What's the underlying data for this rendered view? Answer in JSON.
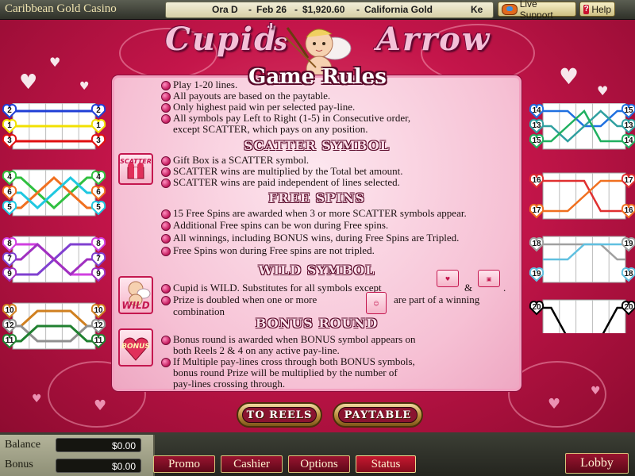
{
  "topbar": {
    "brand": "Caribbean Gold Casino",
    "session": {
      "name": "Ora D",
      "date": "Feb 26",
      "amount": "$1,920.60",
      "game": "California Gold",
      "tail": "Ke"
    },
    "live_support": "Live Support",
    "help": "Help"
  },
  "title": {
    "c": "Cupid",
    "s": "s",
    "a": "Arrow"
  },
  "panel": {
    "heading": "Game Rules",
    "intro": [
      "Play 1-20 lines.",
      "All payouts are based on the paytable.",
      "Only highest paid win per selected pay-line.",
      "All symbols pay Left to Right (1-5) in Consecutive order,",
      "except SCATTER, which pays on any position."
    ],
    "scatter": {
      "heading": "SCATTER SYMBOL",
      "icon_text": "SCATTER",
      "lines": [
        "Gift Box is a SCATTER symbol.",
        "SCATTER wins are multiplied by the Total bet amount.",
        "SCATTER wins are paid independent of lines selected."
      ]
    },
    "free": {
      "heading": "FREE SPINS",
      "lines": [
        "15 Free Spins are awarded when 3 or more SCATTER symbols appear.",
        "Additional Free spins can be won during Free spins.",
        "All winnings, including BONUS wins, during Free Spins are Tripled.",
        "Free Spins won during Free spins are not tripled."
      ]
    },
    "wild": {
      "heading": "WILD SYMBOL",
      "icon_text": "WILD",
      "line1": "Cupid is WILD. Substitutes for all symbols except",
      "amp": "&",
      "dot": ".",
      "line2a": "Prize is doubled when one or more",
      "line2b": "are part of a winning",
      "line3": "combination"
    },
    "bonus": {
      "heading": "BONUS ROUND",
      "icon_text": "BONUS",
      "lines": [
        "Bonus round is awarded when BONUS symbol appears on",
        "both Reels 2 & 4 on any active pay-line.",
        "If Multiple pay-lines cross through both BONUS symbols,",
        "bonus round Prize will be multiplied by the number of",
        "pay-lines crossing through."
      ]
    }
  },
  "buttons": {
    "to_reels": "TO REELS",
    "paytable": "PAYTABLE"
  },
  "bottom": {
    "balance_label": "Balance",
    "balance_value": "$0.00",
    "bonus_label": "Bonus",
    "bonus_value": "$0.00",
    "promo": "Promo",
    "cashier": "Cashier",
    "options": "Options",
    "status": "Status",
    "lobby": "Lobby"
  },
  "paylines": {
    "left": [
      {
        "numbers": [
          2,
          1,
          3
        ],
        "colors": [
          "#1f3fd6",
          "#f2e000",
          "#e01010"
        ]
      },
      {
        "numbers": [
          4,
          6,
          5
        ],
        "colors": [
          "#30c040",
          "#f07020",
          "#20c8e0"
        ]
      },
      {
        "numbers": [
          8,
          7,
          9
        ],
        "colors": [
          "#d040e0",
          "#8040d0",
          "#a030c0"
        ]
      },
      {
        "numbers": [
          10,
          12,
          11
        ],
        "colors": [
          "#d08020",
          "#909090",
          "#208030"
        ]
      }
    ],
    "right": [
      {
        "numbers_left": [
          14,
          13,
          15
        ],
        "numbers_right": [
          15,
          13,
          14
        ],
        "colors": [
          "#2070e0",
          "#30a0a0",
          "#20b060"
        ]
      },
      {
        "numbers_left": [
          16,
          17
        ],
        "numbers_right": [
          17,
          16
        ],
        "colors": [
          "#e03030",
          "#f07020"
        ]
      },
      {
        "numbers_left": [
          18,
          19
        ],
        "numbers_right": [
          19,
          18
        ],
        "colors": [
          "#a0a0a0",
          "#60c0e0"
        ]
      },
      {
        "numbers_left": [
          20
        ],
        "numbers_right": [
          20
        ],
        "colors": [
          "#000000"
        ]
      }
    ]
  },
  "colors": {
    "panel_border": "#f2a0bf",
    "accent": "#c4174f",
    "gold": "#b98b3a"
  }
}
